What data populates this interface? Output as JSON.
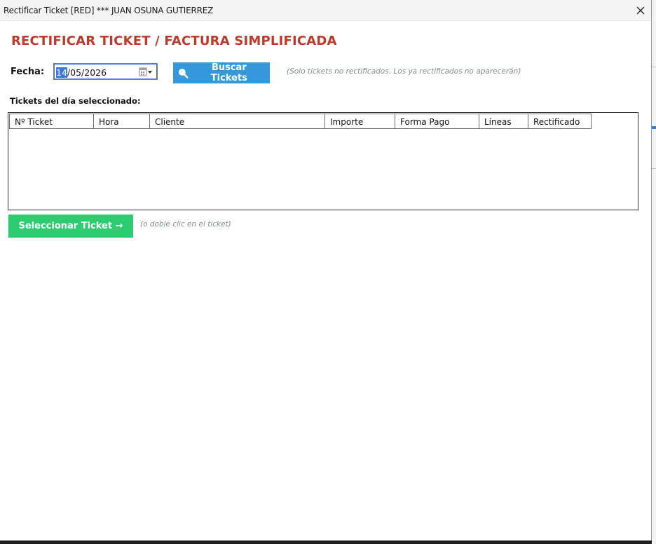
{
  "window": {
    "title": "Rectificar Ticket [RED] *** JUAN OSUNA GUTIERREZ",
    "close_icon": "close-icon"
  },
  "form": {
    "heading": "RECTIFICAR TICKET / FACTURA SIMPLIFICADA",
    "date_label": "Fecha:",
    "date_value_selected": "14",
    "date_value_rest": "/05/2026",
    "search_button_label": "Buscar Tickets",
    "search_icon": "search-icon",
    "search_hint": "(Solo tickets no rectificados. Los ya rectificados no aparecerán)",
    "tickets_label": "Tickets del día seleccionado:",
    "select_button_label": "Seleccionar Ticket →",
    "select_hint": "(o doble clic en el ticket)"
  },
  "table": {
    "columns": [
      "Nº Ticket",
      "Hora",
      "Cliente",
      "Importe",
      "Forma Pago",
      "Líneas",
      "Rectificado"
    ],
    "rows": []
  },
  "colors": {
    "heading": "#c0392b",
    "search_button": "#3498db",
    "select_button": "#2ecc71",
    "hint": "#7f8c8d"
  }
}
